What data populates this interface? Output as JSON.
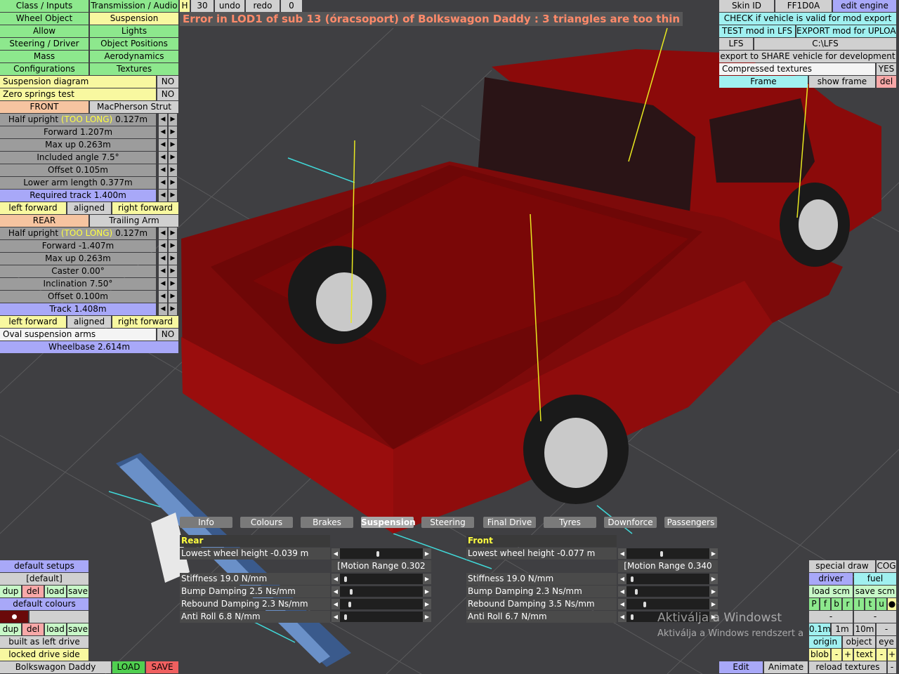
{
  "error_message": "Error in LOD1 of sub 13 (óracsoport) of Bolkswagon Daddy : 3 triangles are too thin",
  "top_menu": {
    "class_inputs": "Class / Inputs",
    "transmission_audio": "Transmission / Audio",
    "wheel_object": "Wheel Object",
    "suspension": "Suspension",
    "allow": "Allow",
    "lights": "Lights",
    "steering_driver": "Steering / Driver",
    "object_positions": "Object Positions",
    "mass": "Mass",
    "aerodynamics": "Aerodynamics",
    "configurations": "Configurations",
    "textures": "Textures"
  },
  "toolbar": {
    "h": "H",
    "num": "30",
    "undo": "undo",
    "redo": "redo",
    "redo_count": "0"
  },
  "susp": {
    "diagram_label": "Suspension diagram",
    "diagram_value": "NO",
    "zero_label": "Zero springs test",
    "zero_value": "NO",
    "front_label": "FRONT",
    "front_type": "MacPherson Strut",
    "f_half_upright_pre": "Half upright",
    "f_half_upright_warn": "(TOO LONG)",
    "f_half_upright_val": "0.127m",
    "f_forward": "Forward 1.207m",
    "f_maxup": "Max up 0.263m",
    "f_angle": "Included angle 7.5°",
    "f_offset": "Offset 0.105m",
    "f_lower_arm": "Lower arm length 0.377m",
    "f_track": "Required track 1.400m",
    "f_left": "left forward",
    "f_aligned": "aligned",
    "f_right": "right forward",
    "rear_label": "REAR",
    "rear_type": "Trailing Arm",
    "r_half_upright_pre": "Half upright",
    "r_half_upright_warn": "(TOO LONG)",
    "r_half_upright_val": "0.127m",
    "r_forward": "Forward -1.407m",
    "r_maxup": "Max up 0.263m",
    "r_caster": "Caster 0.00°",
    "r_incl": "Inclination 7.50°",
    "r_offset": "Offset 0.100m",
    "r_track": "Track 1.408m",
    "r_left": "left forward",
    "r_aligned": "aligned",
    "r_right": "right forward",
    "oval_label": "Oval suspension arms",
    "oval_value": "NO",
    "wheelbase": "Wheelbase 2.614m"
  },
  "right_panel": {
    "skin_id": "Skin ID",
    "skin_code": "FF1D0A",
    "edit_engine": "edit engine",
    "check": "CHECK if vehicle is valid for mod export",
    "test": "TEST mod in LFS",
    "export": "EXPORT mod for UPLOAD",
    "lfs": "LFS",
    "path": "C:\\LFS",
    "share": "export to SHARE vehicle for development",
    "compressed": "Compressed textures",
    "compressed_val": "YES",
    "frame": "Frame",
    "show_frame": "show frame",
    "del": "del"
  },
  "bottom_tabs": [
    "Info",
    "Colours",
    "Brakes",
    "Suspension",
    "Steering",
    "Final Drive",
    "Tyres",
    "Downforce",
    "Passengers"
  ],
  "rear": {
    "title": "Rear",
    "lowest": "Lowest wheel height -0.039 m",
    "motion": "[Motion Range 0.302 m]",
    "stiffness": "Stiffness 19.0 N/mm",
    "bump": "Bump Damping 2.5 Ns/mm",
    "rebound": "Rebound Damping 2.3 Ns/mm",
    "antiroll": "Anti Roll 6.8 N/mm"
  },
  "front": {
    "title": "Front",
    "lowest": "Lowest wheel height -0.077 m",
    "motion": "[Motion Range 0.340 m]",
    "stiffness": "Stiffness 19.0 N/mm",
    "bump": "Bump Damping 2.3 Ns/mm",
    "rebound": "Rebound Damping 3.5 Ns/mm",
    "antiroll": "Anti Roll 6.7 N/mm"
  },
  "bottom_left": {
    "default_setups": "default setups",
    "default": "[default]",
    "dup": "dup",
    "del": "del",
    "load": "load",
    "save": "save",
    "default_colours": "default colours",
    "built_left": "built as left drive",
    "locked": "locked drive side",
    "vehicle_name": "Bolkswagon Daddy",
    "load_btn": "LOAD",
    "save_btn": "SAVE"
  },
  "bottom_right": {
    "special_draw": "special draw",
    "cog": "COG",
    "driver": "driver",
    "fuel": "fuel",
    "load_scm": "load scm",
    "save_scm": "save scm",
    "letters": [
      "P",
      "f",
      "b",
      "r",
      "l",
      "t",
      "u"
    ],
    "minus": "-",
    "d01": "0.1m",
    "d1": "1m",
    "d10": "10m",
    "origin": "origin",
    "object": "object",
    "eye": "eye",
    "blob": "blob",
    "plus": "+",
    "text": "text",
    "edit": "Edit",
    "animate": "Animate",
    "reload": "reload textures"
  },
  "watermark": {
    "line1": "Aktiválja a Windowst",
    "line2": "Aktiválja a Windows rendszert a"
  },
  "colors": {
    "car_body": "#8b0a0a",
    "warning": "#ffff40",
    "error": "#ff8a6a"
  },
  "icons": [
    "arrow-left-icon",
    "arrow-right-icon",
    "colour-dot-icon"
  ]
}
